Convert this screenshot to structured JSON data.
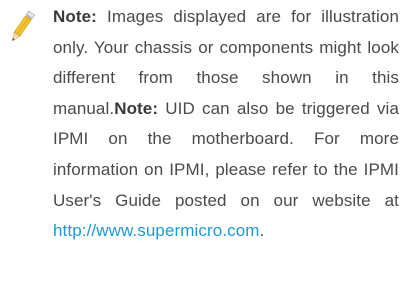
{
  "icon": {
    "name": "pencil-icon",
    "colors": {
      "body": "#f2c12e",
      "wood": "#f6dfa8",
      "tip": "#555555",
      "eraser": "#e8e8e8"
    }
  },
  "note": {
    "label1": "Note:",
    "text1": " Images displayed are for illus­tration only. Your chassis or compo­nents might look different from those shown in this manual.",
    "label2": "Note:",
    "text2": " UID can also be triggered via IPMI on the motherboard. For more information on IPMI, please refer to the IPMI User's Guide posted on our website at ",
    "link": "http://www.supermicro.com",
    "end": "."
  },
  "colors": {
    "text": "#4a4a4a",
    "link": "#1a9bd7"
  }
}
